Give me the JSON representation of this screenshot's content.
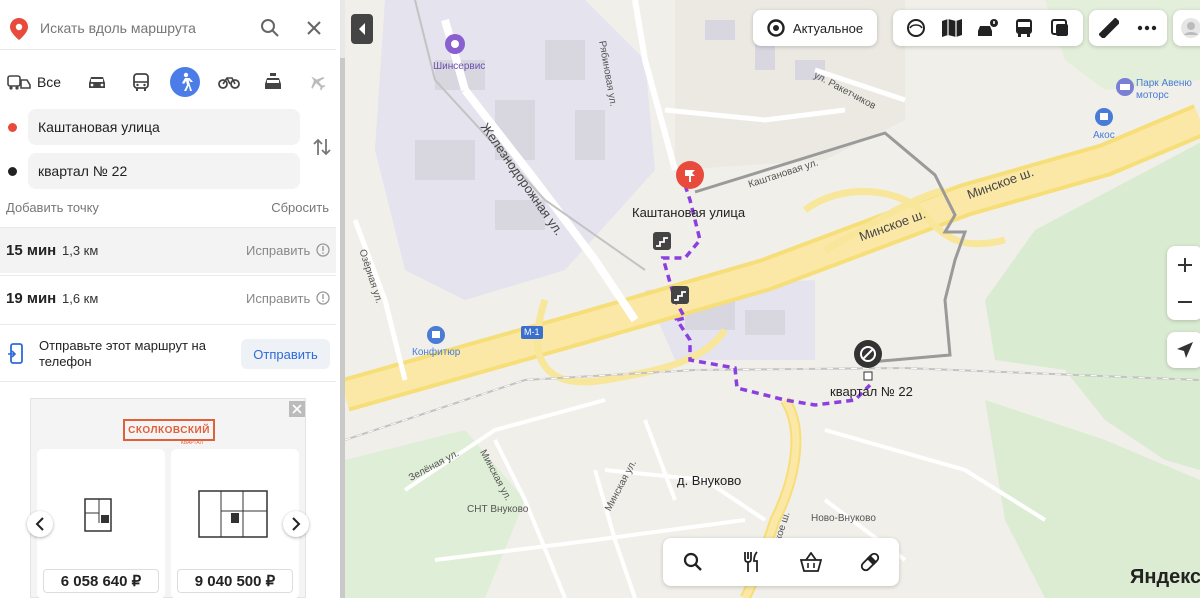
{
  "search": {
    "placeholder": "Искать вдоль маршрута"
  },
  "modes": {
    "all_label": "Все",
    "active_mode": "pedestrian"
  },
  "points": {
    "from": "Каштановая улица",
    "to": "квартал № 22"
  },
  "actions": {
    "add_point": "Добавить точку",
    "reset": "Сбросить"
  },
  "routes": [
    {
      "time": "15 мин",
      "distance": "1,3 км",
      "fix": "Исправить"
    },
    {
      "time": "19 мин",
      "distance": "1,6 км",
      "fix": "Исправить"
    }
  ],
  "send": {
    "text": "Отправьте этот маршрут на телефон",
    "button": "Отправить"
  },
  "ad": {
    "brand": "СКОЛКОВСКИЙ",
    "brand_sub": "КВАРТАЛ",
    "prices": [
      "6 058 640 ₽",
      "9 040 500 ₽"
    ]
  },
  "map": {
    "actual_label": "Актуальное",
    "labels": {
      "shinservice": "Шинсервис",
      "ryabinovaya": "Рябиновая ул.",
      "raketchikov": "ул. Ракетчиков",
      "park": "Парк Авеню",
      "park2": "моторс",
      "akos": "Акос",
      "zheleznodorozhnaya": "Железнодорожная ул.",
      "kashtanovaya_road": "Каштановая ул.",
      "kashtanovaya": "Каштановая улица",
      "minskoe1": "Минское ш.",
      "minskoe2": "Минское ш.",
      "ozernaya": "Озёрная ул.",
      "konfityur": "Конфитюр",
      "m1": "М-1",
      "kvartal": "квартал № 22",
      "zelenaya": "Зелёная ул.",
      "minskaya1": "Минская ул.",
      "minskaya2": "Минская ул.",
      "vnukovo": "д. Внуково",
      "snt": "СНТ Внуково",
      "novo": "Ново-Внуково",
      "vskoe": "вское ш."
    },
    "logo": "Яндекс"
  },
  "colors": {
    "route": "#8b3fe0",
    "accent": "#4b7ce8",
    "start": "#e84b3c"
  }
}
